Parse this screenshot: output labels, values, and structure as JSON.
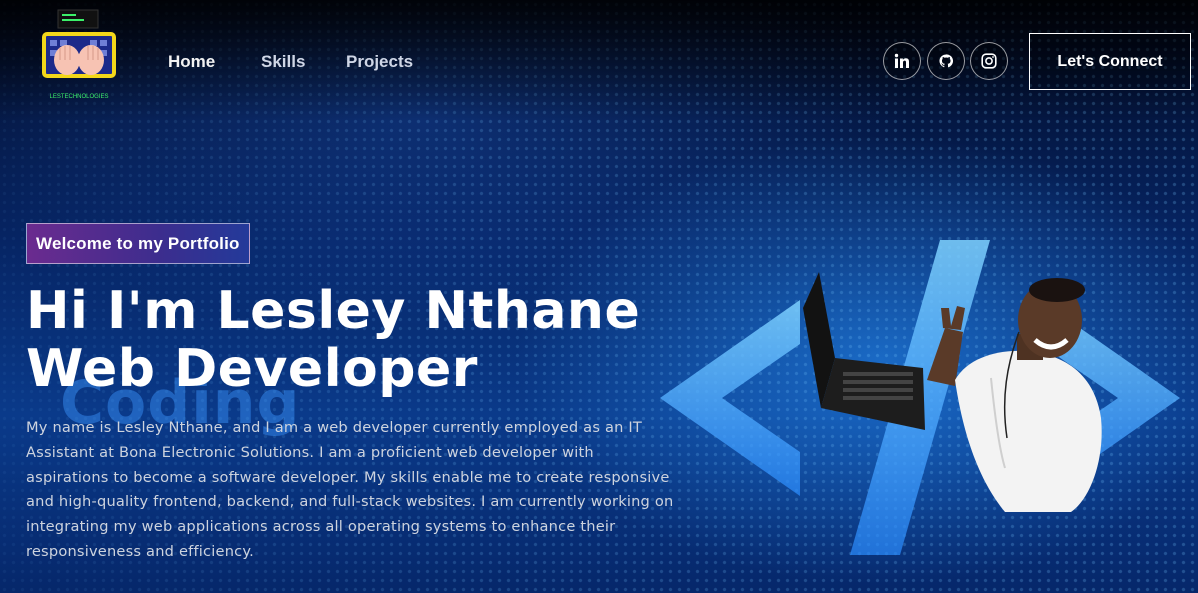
{
  "logo": {
    "caption": "LESTECHNOLOGIES"
  },
  "nav": {
    "links": [
      {
        "label": "Home"
      },
      {
        "label": "Skills"
      },
      {
        "label": "Projects"
      }
    ],
    "social": [
      {
        "name": "linkedin-icon"
      },
      {
        "name": "github-icon"
      },
      {
        "name": "instagram-icon"
      }
    ],
    "connect_label": "Let's Connect"
  },
  "hero": {
    "tagline": "Welcome to my Portfolio",
    "title_line1": "Hi I'm Lesley Nthane",
    "title_line2": "Web Developer",
    "description": "My name is Lesley Nthane, and I am a web developer currently employed as an IT Assistant at Bona Electronic Solutions. I am a proficient web developer with aspirations to become a software developer. My skills enable me to create responsive and high-quality frontend, backend, and full-stack websites. I am currently working on integrating my web applications across all operating systems to enhance their responsiveness and efficiency."
  },
  "background": {
    "word": "Coding"
  },
  "colors": {
    "accent_purple": "#6b2b8f",
    "accent_blue": "#233a9a",
    "background": "#031a4a"
  }
}
